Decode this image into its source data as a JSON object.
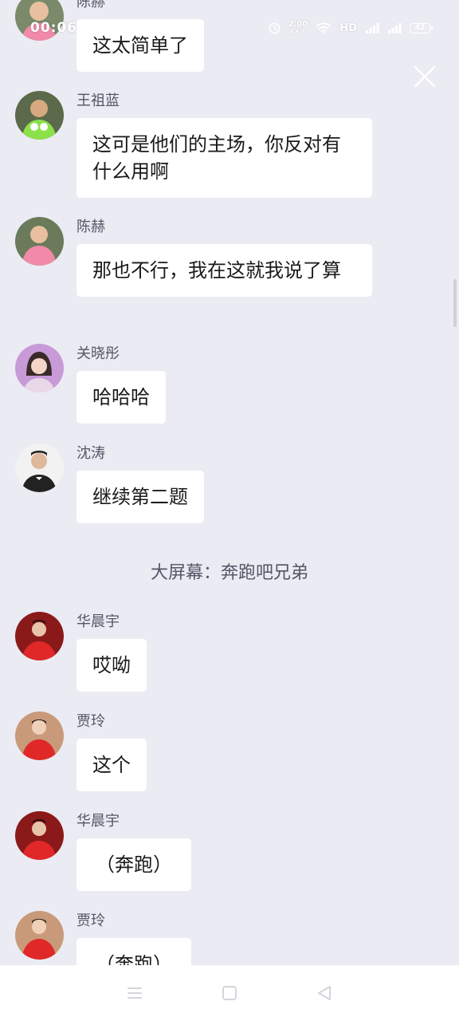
{
  "status_bar": {
    "time": "00:06",
    "network_speed": "2.00",
    "network_speed_unit": "KB/S",
    "hd_label": "HD",
    "signal1": "4G",
    "signal2": "4G",
    "battery": "42"
  },
  "messages": [
    {
      "sender": "陈赫",
      "text": "这太简单了",
      "avatar": "avatar-pink-shirt"
    },
    {
      "sender": "王祖蓝",
      "text": "这可是他们的主场，你反对有什么用啊",
      "avatar": "avatar-green-shirt"
    },
    {
      "sender": "陈赫",
      "text": "那也不行，我在这就我说了算",
      "avatar": "avatar-pink-shirt"
    },
    {
      "sender": "关晓彤",
      "text": "哈哈哈",
      "avatar": "avatar-woman"
    },
    {
      "sender": "沈涛",
      "text": "继续第二题",
      "avatar": "avatar-man-suit"
    },
    {
      "sender": "华晨宇",
      "text": "哎呦",
      "avatar": "avatar-red-jacket"
    },
    {
      "sender": "贾玲",
      "text": "这个",
      "avatar": "avatar-red-jacket"
    },
    {
      "sender": "华晨宇",
      "text": "（奔跑）",
      "avatar": "avatar-red-jacket"
    },
    {
      "sender": "贾玲",
      "text": "（奔跑）",
      "avatar": "avatar-red-jacket"
    }
  ],
  "system_message": "大屏幕：奔跑吧兄弟",
  "colors": {
    "background": "#ebebf3",
    "bubble": "#ffffff",
    "sender_text": "#555566",
    "nav_bar": "#ffffff"
  },
  "icons": {
    "close": "close-icon",
    "nav_menu": "menu-icon",
    "nav_home": "home-icon",
    "nav_back": "back-icon"
  }
}
